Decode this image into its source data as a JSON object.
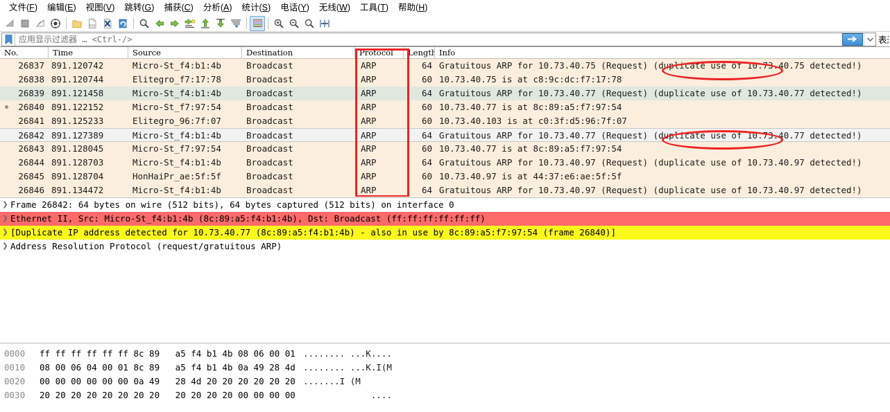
{
  "menu": {
    "items": [
      {
        "label": "文件(F)",
        "mnemonic": "F"
      },
      {
        "label": "编辑(E)",
        "mnemonic": "E"
      },
      {
        "label": "视图(V)",
        "mnemonic": "V"
      },
      {
        "label": "跳转(G)",
        "mnemonic": "G"
      },
      {
        "label": "捕获(C)",
        "mnemonic": "C"
      },
      {
        "label": "分析(A)",
        "mnemonic": "A"
      },
      {
        "label": "统计(S)",
        "mnemonic": "S"
      },
      {
        "label": "电话(Y)",
        "mnemonic": "Y"
      },
      {
        "label": "无线(W)",
        "mnemonic": "W"
      },
      {
        "label": "工具(T)",
        "mnemonic": "T"
      },
      {
        "label": "帮助(H)",
        "mnemonic": "H"
      }
    ]
  },
  "toolbar": {
    "icons": [
      "start-capture-icon",
      "stop-capture-icon",
      "restart-capture-icon",
      "capture-options-icon",
      "open-file-icon",
      "save-file-icon",
      "close-file-icon",
      "reload-file-icon",
      "find-packet-icon",
      "go-back-icon",
      "go-forward-icon",
      "go-to-packet-icon",
      "go-first-packet-icon",
      "go-last-packet-icon",
      "autoscroll-icon",
      "colorize-icon",
      "zoom-in-icon",
      "zoom-out-icon",
      "zoom-reset-icon",
      "resize-columns-icon"
    ]
  },
  "filter": {
    "placeholder": "应用显示过滤器 … <Ctrl-/>",
    "value": "",
    "bookmark_icon": "bookmark-icon",
    "apply_icon": "arrow-right-icon",
    "dropdown_icon": "chevron-down-icon",
    "expression_label": "表达式…"
  },
  "packet_list": {
    "columns": [
      "No.",
      "Time",
      "Source",
      "Destination",
      "Protocol",
      "Length",
      "Info"
    ],
    "rows": [
      {
        "no": "26837",
        "time": "891.120742",
        "source": "Micro-St_f4:b1:4b",
        "destination": "Broadcast",
        "protocol": "ARP",
        "length": "64",
        "info": "Gratuitous ARP for 10.73.40.75 (Request) (duplicate use of 10.73.40.75 detected!)",
        "style": "normal",
        "marker": false
      },
      {
        "no": "26838",
        "time": "891.120744",
        "source": "Elitegro_f7:17:78",
        "destination": "Broadcast",
        "protocol": "ARP",
        "length": "60",
        "info": "10.73.40.75 is at c8:9c:dc:f7:17:78",
        "style": "normal",
        "marker": false
      },
      {
        "no": "26839",
        "time": "891.121458",
        "source": "Micro-St_f4:b1:4b",
        "destination": "Broadcast",
        "protocol": "ARP",
        "length": "64",
        "info": "Gratuitous ARP for 10.73.40.77 (Request) (duplicate use of 10.73.40.77 detected!)",
        "style": "alt",
        "marker": false
      },
      {
        "no": "26840",
        "time": "891.122152",
        "source": "Micro-St_f7:97:54",
        "destination": "Broadcast",
        "protocol": "ARP",
        "length": "60",
        "info": "10.73.40.77 is at 8c:89:a5:f7:97:54",
        "style": "normal",
        "marker": true
      },
      {
        "no": "26841",
        "time": "891.125233",
        "source": "Elitegro_96:7f:07",
        "destination": "Broadcast",
        "protocol": "ARP",
        "length": "60",
        "info": "10.73.40.103 is at c0:3f:d5:96:7f:07",
        "style": "normal",
        "marker": false
      },
      {
        "no": "26842",
        "time": "891.127389",
        "source": "Micro-St_f4:b1:4b",
        "destination": "Broadcast",
        "protocol": "ARP",
        "length": "64",
        "info": "Gratuitous ARP for 10.73.40.77 (Request) (duplicate use of 10.73.40.77 detected!)",
        "style": "selected",
        "marker": false
      },
      {
        "no": "26843",
        "time": "891.128045",
        "source": "Micro-St_f7:97:54",
        "destination": "Broadcast",
        "protocol": "ARP",
        "length": "60",
        "info": "10.73.40.77 is at 8c:89:a5:f7:97:54",
        "style": "normal",
        "marker": false
      },
      {
        "no": "26844",
        "time": "891.128703",
        "source": "Micro-St_f4:b1:4b",
        "destination": "Broadcast",
        "protocol": "ARP",
        "length": "64",
        "info": "Gratuitous ARP for 10.73.40.97 (Request) (duplicate use of 10.73.40.97 detected!)",
        "style": "normal",
        "marker": false
      },
      {
        "no": "26845",
        "time": "891.128704",
        "source": "HonHaiPr_ae:5f:5f",
        "destination": "Broadcast",
        "protocol": "ARP",
        "length": "60",
        "info": "10.73.40.97 is at 44:37:e6:ae:5f:5f",
        "style": "normal",
        "marker": false
      },
      {
        "no": "26846",
        "time": "891.134472",
        "source": "Micro-St_f4:b1:4b",
        "destination": "Broadcast",
        "protocol": "ARP",
        "length": "64",
        "info": "Gratuitous ARP for 10.73.40.97 (Request) (duplicate use of 10.73.40.97 detected!)",
        "style": "normal",
        "marker": false
      }
    ]
  },
  "annotations": {
    "accent_color": "#ee2222",
    "rect": {
      "name": "protocol-column-highlight"
    },
    "ellipses": [
      {
        "name": "duplicate-use-highlight-1"
      },
      {
        "name": "duplicate-use-highlight-2"
      }
    ]
  },
  "packet_detail": {
    "rows": [
      {
        "text": "Frame 26842: 64 bytes on wire (512 bits), 64 bytes captured (512 bits) on interface 0",
        "highlight": "none"
      },
      {
        "text": "Ethernet II, Src: Micro-St_f4:b1:4b (8c:89:a5:f4:b1:4b), Dst: Broadcast (ff:ff:ff:ff:ff:ff)",
        "highlight": "red"
      },
      {
        "text": "[Duplicate IP address detected for 10.73.40.77 (8c:89:a5:f4:b1:4b) - also in use by 8c:89:a5:f7:97:54 (frame 26840)]",
        "highlight": "yellow"
      },
      {
        "text": "Address Resolution Protocol (request/gratuitous ARP)",
        "highlight": "none"
      }
    ],
    "colors": {
      "red": "#fc6a6a",
      "yellow": "#fbf81c"
    }
  },
  "hex_dump": {
    "rows": [
      {
        "offset": "0000",
        "bytes": "ff ff ff ff ff ff 8c 89   a5 f4 b1 4b 08 06 00 01",
        "ascii": "........ ...K...."
      },
      {
        "offset": "0010",
        "bytes": "08 00 06 04 00 01 8c 89   a5 f4 b1 4b 0a 49 28 4d",
        "ascii": "........ ...K.I(M"
      },
      {
        "offset": "0020",
        "bytes": "00 00 00 00 00 00 0a 49   28 4d 20 20 20 20 20 20",
        "ascii": ".......I (M      "
      },
      {
        "offset": "0030",
        "bytes": "20 20 20 20 20 20 20 20   20 20 20 20 00 00 00 00",
        "ascii": "             ...."
      }
    ]
  }
}
